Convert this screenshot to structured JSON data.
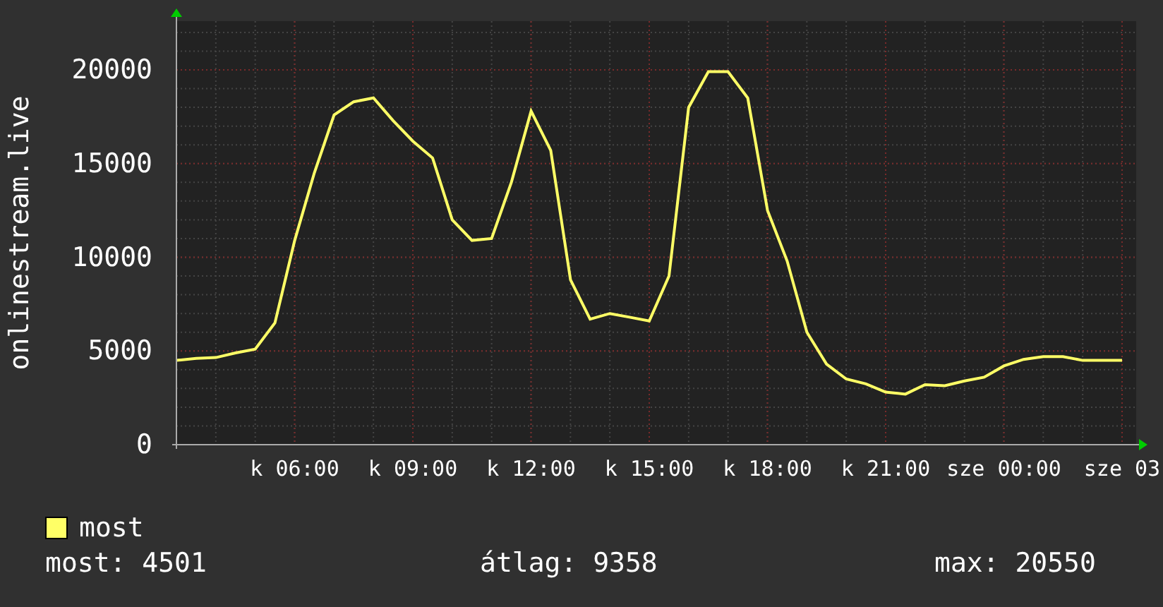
{
  "graph": {
    "chart_data": {
      "type": "line",
      "ylabel": "onlinestream.live",
      "categories": [
        null,
        null,
        null,
        null,
        null,
        null,
        "k 06:00",
        null,
        null,
        null,
        null,
        null,
        "k 09:00",
        null,
        null,
        null,
        null,
        null,
        "k 12:00",
        null,
        null,
        null,
        null,
        null,
        "k 15:00",
        null,
        null,
        null,
        null,
        null,
        "k 18:00",
        null,
        null,
        null,
        null,
        null,
        "k 21:00",
        null,
        null,
        null,
        null,
        null,
        "sze 00:00",
        null,
        null,
        null,
        null,
        null,
        "sze 03"
      ],
      "series": [
        {
          "name": "most",
          "color": "#ffff66",
          "values": [
            4500,
            4600,
            4650,
            4900,
            5100,
            6500,
            10900,
            14500,
            17600,
            18300,
            18500,
            17300,
            16200,
            15300,
            12000,
            10900,
            11000,
            14000,
            17800,
            15700,
            8800,
            6700,
            7000,
            6800,
            6600,
            9000,
            18000,
            19900,
            19900,
            18500,
            12500,
            9800,
            6000,
            4300,
            3500,
            3250,
            2800,
            2700,
            3200,
            3150,
            3400,
            3600,
            4200,
            4550,
            4700,
            4700,
            4500,
            4500,
            4500
          ]
        }
      ],
      "ylim": [
        0,
        22600
      ],
      "grid": true,
      "yticks": [
        0,
        5000,
        10000,
        15000,
        20000
      ]
    }
  },
  "stats": [
    "most: 4501",
    "átlag: 9358",
    "max: 20550"
  ]
}
